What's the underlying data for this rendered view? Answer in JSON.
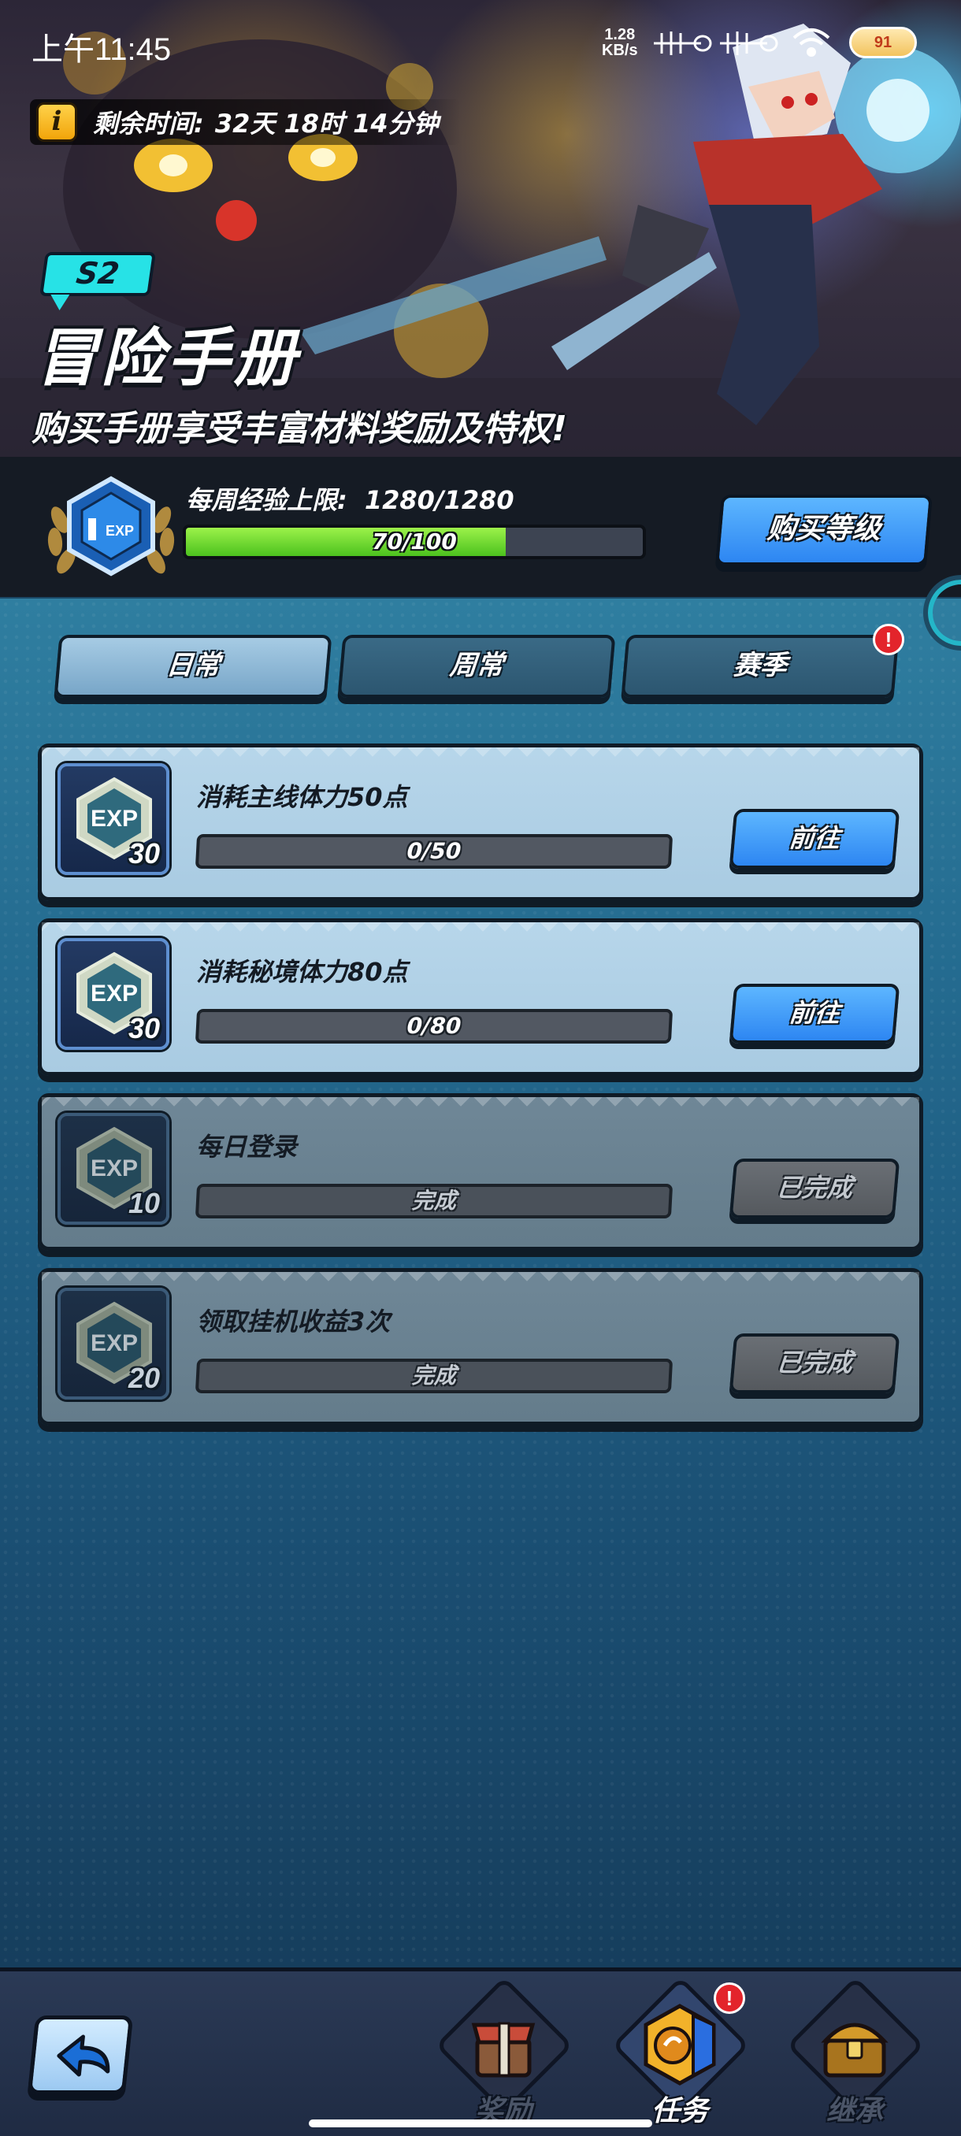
{
  "status_bar": {
    "time": "上午11:45",
    "net_rate_value": "1.28",
    "net_rate_unit": "KB/s",
    "battery": "91"
  },
  "banner": {
    "remaining_label": "剩余时间:",
    "remaining_value": "32天 18时 14分钟",
    "season": "S2",
    "title": "冒险手册",
    "subtitle": "购买手册享受丰富材料奖励及特权!"
  },
  "level": {
    "badge_level": "1",
    "badge_text": "EXP",
    "weekly_cap_label": "每周经验上限:",
    "weekly_cap_value": "1280/1280",
    "xp_text": "70/100",
    "xp_progress": 0.7,
    "buy_button": "购买等级"
  },
  "tabs": [
    {
      "label": "日常",
      "active": true
    },
    {
      "label": "周常",
      "active": false
    },
    {
      "label": "赛季",
      "active": false,
      "alert": "!"
    }
  ],
  "tasks": [
    {
      "exp_label": "EXP",
      "exp": "30",
      "name": "消耗主线体力50点",
      "progress": "0/50",
      "button": "前往",
      "state": "open"
    },
    {
      "exp_label": "EXP",
      "exp": "30",
      "name": "消耗秘境体力80点",
      "progress": "0/80",
      "button": "前往",
      "state": "open"
    },
    {
      "exp_label": "EXP",
      "exp": "10",
      "name": "每日登录",
      "progress": "完成",
      "button": "已完成",
      "state": "done"
    },
    {
      "exp_label": "EXP",
      "exp": "20",
      "name": "领取挂机收益3次",
      "progress": "完成",
      "button": "已完成",
      "state": "done"
    }
  ],
  "bottom_nav": {
    "items": [
      {
        "label": "奖励",
        "icon": "gift-chest-icon",
        "active": false
      },
      {
        "label": "任务",
        "icon": "quest-hex-icon",
        "active": true,
        "alert": "!"
      },
      {
        "label": "继承",
        "icon": "treasure-chest-icon",
        "active": false
      }
    ]
  },
  "colors": {
    "accent_blue": "#2d86f2",
    "progress_green": "#4cc21e",
    "alert_red": "#e3242b",
    "season_cyan": "#27e2e6"
  }
}
